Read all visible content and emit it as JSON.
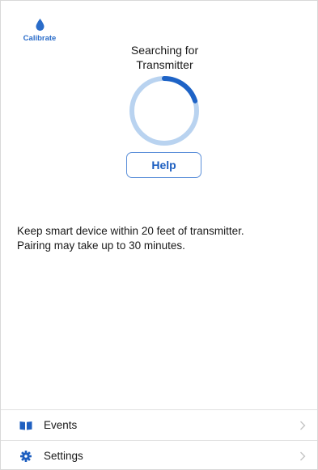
{
  "calibrate": {
    "label": "Calibrate",
    "icon": "drop-icon"
  },
  "status": {
    "line1": "Searching for",
    "line2": "Transmitter"
  },
  "spinner": {
    "progress_fraction": 0.2
  },
  "help": {
    "label": "Help"
  },
  "info": {
    "line1": "Keep smart device within 20 feet of transmitter.",
    "line2": "Pairing may take up to 30 minutes."
  },
  "menu": {
    "items": [
      {
        "label": "Events",
        "icon": "book-icon"
      },
      {
        "label": "Settings",
        "icon": "gear-icon"
      }
    ]
  },
  "colors": {
    "accent": "#2a6cc9",
    "spinner_track": "#b9d3f0",
    "spinner_arc": "#1e63c6",
    "divider": "#e2e2e2"
  }
}
